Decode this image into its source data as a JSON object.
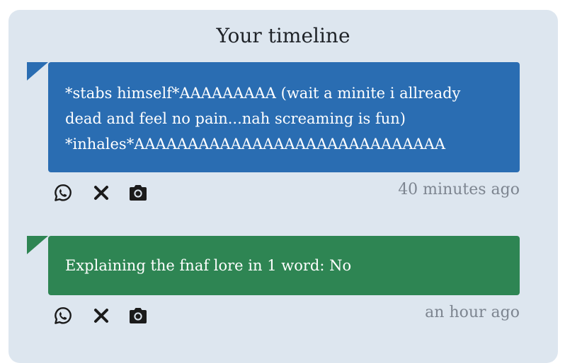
{
  "timeline": {
    "title": "Your timeline",
    "posts": [
      {
        "text": "*stabs himself*AAAAAAAAA (wait a minite i allready\ndead and feel no pain...nah screaming is fun)\n*inhales*AAAAAAAAAAAAAAAAAAAAAAAAAAAAA",
        "color": "#2a6db2",
        "time": "40 minutes ago",
        "actions": [
          "whatsapp-icon",
          "x-icon",
          "camera-icon"
        ]
      },
      {
        "text": "Explaining the fnaf lore in 1 word: No",
        "color": "#2e8553",
        "time": "an hour ago",
        "actions": [
          "whatsapp-icon",
          "x-icon",
          "camera-icon"
        ]
      }
    ]
  }
}
